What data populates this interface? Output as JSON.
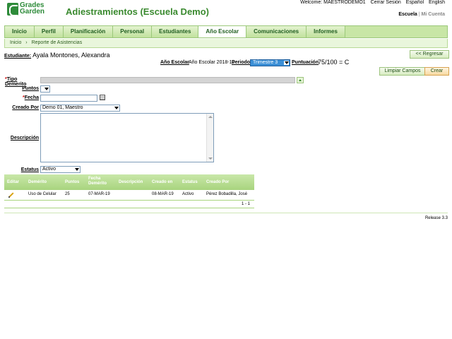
{
  "header": {
    "logo_line1": "Grades",
    "logo_line2": "Garden",
    "title": "Adiestramientos (Escuela Demo)",
    "welcome": "Welcome: MAESTRODEMO1",
    "logout": "Cerrar Sesión",
    "lang_es": "Español",
    "lang_en": "English",
    "school": "Escuela",
    "separator": "|",
    "account": "Mi Cuenta"
  },
  "nav": {
    "tabs": [
      {
        "label": "Inicio"
      },
      {
        "label": "Perfil"
      },
      {
        "label": "Planificación"
      },
      {
        "label": "Personal"
      },
      {
        "label": "Estudiantes"
      },
      {
        "label": "Año Escolar"
      },
      {
        "label": "Comunicaciones"
      },
      {
        "label": "Informes"
      }
    ],
    "active": "Año Escolar"
  },
  "breadcrumb": {
    "home": "Inicio",
    "sep": "›",
    "current": "Reporte de Asistencias"
  },
  "student": {
    "label": "Estudiante:",
    "name": "Ayala Montones, Alexandra",
    "back_button": "<< Regresar"
  },
  "period_bar": {
    "year_label": "Año Escolar",
    "year_value": "Año Escolar 2018-19",
    "period_label": "Periodo",
    "period_value": "Trimestre 3",
    "score_label": "Puntuación",
    "score_value": "75/100 = C"
  },
  "actions": {
    "clear": "Limpiar Campos",
    "create": "Crear"
  },
  "form": {
    "tipo_label": "Tipo Demerito",
    "puntos_label": "Puntos",
    "fecha_label": "Fecha",
    "creado_label": "Creado Por",
    "creado_value": "Demo 01, Maestro",
    "descripcion_label": "Descripción",
    "estatus_label": "Estatus",
    "estatus_value": "Activo",
    "required_mark": "*"
  },
  "table": {
    "headers": [
      "Editar",
      "Demérito",
      "Puntos",
      "Fecha Demérito",
      "Descripción",
      "Creado en",
      "Estatus",
      "Creado Por"
    ],
    "rows": [
      {
        "demerito": "Uso de Celular",
        "puntos": "25",
        "fecha": "07-MAR-19",
        "descripcion": "",
        "creado_en": "08-MAR-19",
        "estatus": "Activo",
        "creado_por": "Pérez Bobadilla, José"
      }
    ],
    "pagination": "1 - 1"
  },
  "footer": {
    "release": "Release 3.3"
  },
  "colors": {
    "brand_green": "#2e8b3a",
    "nav_bg": "#c8e6a6",
    "period_select": "#3b8fd6"
  }
}
